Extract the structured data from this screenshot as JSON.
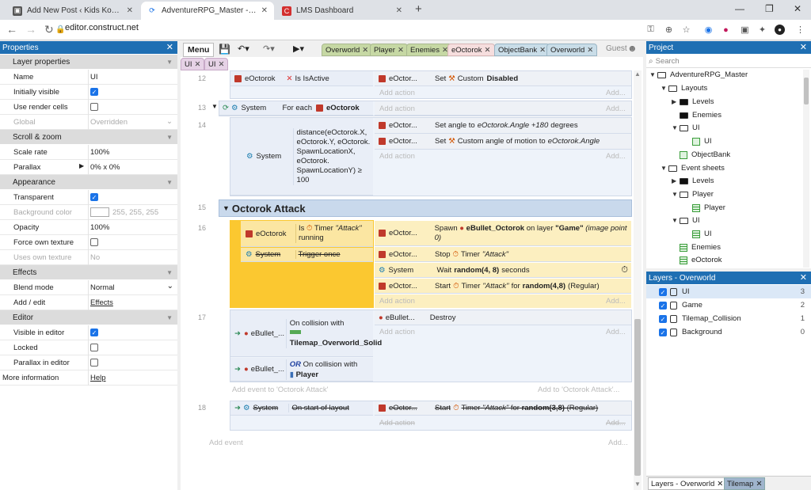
{
  "browser": {
    "tabs": [
      {
        "title": "Add New Post ‹ Kids Koding Aca",
        "active": false
      },
      {
        "title": "AdventureRPG_Master - Constru",
        "active": true
      },
      {
        "title": "LMS Dashboard",
        "active": false
      }
    ],
    "new_tab": "+",
    "url": "editor.construct.net"
  },
  "properties": {
    "title": "Properties",
    "sections": {
      "layer": "Layer properties",
      "scroll": "Scroll & zoom",
      "appearance": "Appearance",
      "effects": "Effects",
      "editor": "Editor"
    },
    "rows": {
      "name": {
        "k": "Name",
        "v": "UI"
      },
      "initially_visible": {
        "k": "Initially visible"
      },
      "use_render_cells": {
        "k": "Use render cells"
      },
      "global": {
        "k": "Global",
        "v": "Overridden"
      },
      "scale_rate": {
        "k": "Scale rate",
        "v": "100%"
      },
      "parallax": {
        "k": "Parallax",
        "v": "0% x 0%"
      },
      "transparent": {
        "k": "Transparent"
      },
      "bg_color": {
        "k": "Background color",
        "v": "255, 255, 255"
      },
      "opacity": {
        "k": "Opacity",
        "v": "100%"
      },
      "force_own_texture": {
        "k": "Force own texture"
      },
      "uses_own_texture": {
        "k": "Uses own texture",
        "v": "No"
      },
      "blend_mode": {
        "k": "Blend mode",
        "v": "Normal"
      },
      "add_edit": {
        "k": "Add / edit",
        "v": "Effects"
      },
      "visible_in_editor": {
        "k": "Visible in editor"
      },
      "locked": {
        "k": "Locked"
      },
      "parallax_in_editor": {
        "k": "Parallax in editor"
      },
      "more_info": {
        "k": "More information",
        "v": "Help"
      }
    }
  },
  "editor": {
    "menu": "Menu",
    "guest": "Guest",
    "tabs": [
      "Overworld",
      "Player",
      "Enemies",
      "eOctorok",
      "ObjectBank",
      "Overworld"
    ],
    "subtabs": [
      "UI",
      "UI"
    ],
    "events": {
      "e12": {
        "num": "12",
        "obj": "eOctorok",
        "cond": "Is IsActive",
        "aobj": "eOctor...",
        "act": "Set",
        "actb": "Custom",
        "actc": "Disabled"
      },
      "e13": {
        "num": "13",
        "sys": "System",
        "cond": "For each",
        "condobj": "eOctorok"
      },
      "e14": {
        "num": "14",
        "sys": "System",
        "cond": "distance(eOctorok.X, eOctorok.Y, eOctorok. SpawnLocationX, eOctorok. SpawnLocationY) ≥ 100",
        "a1obj": "eOctor...",
        "a1": "Set angle to",
        "a1i": "eOctorok.Angle +180",
        "a1e": "degrees",
        "a2obj": "eOctor...",
        "a2": "Set",
        "a2b": "Custom angle of motion to",
        "a2i": "eOctorok.Angle"
      },
      "e15": {
        "num": "15",
        "group": "Octorok Attack"
      },
      "e16": {
        "num": "16",
        "c1obj": "eOctorok",
        "c1": "Is",
        "c1b": "Timer",
        "c1i": "\"Attack\"",
        "c1e": "running",
        "c2sys": "System",
        "c2": "Trigger once",
        "a1obj": "eOctor...",
        "a1": "Spawn",
        "a1b": "eBullet_Octorok",
        "a1c": "on layer",
        "a1d": "\"Game\"",
        "a1i": "(image point 0)",
        "a2obj": "eOctor...",
        "a2": "Stop",
        "a2b": "Timer",
        "a2i": "\"Attack\"",
        "a3sys": "System",
        "a3": "Wait",
        "a3b": "random(4, 8)",
        "a3c": "seconds",
        "a4obj": "eOctor...",
        "a4": "Start",
        "a4b": "Timer",
        "a4i": "\"Attack\"",
        "a4c": "for",
        "a4d": "random(4,8)",
        "a4e": "(Regular)"
      },
      "e17": {
        "num": "17",
        "c1obj": "eBullet_...",
        "c1": "On collision with",
        "c1b": "Tilemap_Overworld_Solid",
        "c2obj": "eBullet_...",
        "c2or": "OR",
        "c2": "On collision with",
        "c2b": "Player",
        "a1obj": "eBullet...",
        "a1": "Destroy"
      },
      "add_event_group": "Add event to 'Octorok Attack'",
      "add_event_group_r": "Add to 'Octorok Attack'...",
      "e18": {
        "num": "18",
        "sys": "System",
        "cond": "On start of layout",
        "aobj": "eOctor...",
        "act": "Start",
        "actb": "Timer",
        "acti": "\"Attack\"",
        "actc": "for",
        "actd": "random(3,8)",
        "acte": "(Regular)"
      },
      "add_action": "Add action",
      "add_dots": "Add...",
      "add_event": "Add event"
    }
  },
  "project": {
    "title": "Project",
    "search_placeholder": "Search",
    "tree": {
      "root": "AdventureRPG_Master",
      "layouts": "Layouts",
      "levels": "Levels",
      "enemies": "Enemies",
      "ui": "UI",
      "ui_layout": "UI",
      "objectbank": "ObjectBank",
      "eventsheets": "Event sheets",
      "levels2": "Levels",
      "player": "Player",
      "player_sheet": "Player",
      "ui2": "UI",
      "ui_sheet": "UI",
      "enemies_sheet": "Enemies",
      "eoctorok_sheet": "eOctorok"
    }
  },
  "layers": {
    "title": "Layers - Overworld",
    "rows": [
      {
        "name": "UI",
        "n": "3"
      },
      {
        "name": "Game",
        "n": "2"
      },
      {
        "name": "Tilemap_Collision",
        "n": "1"
      },
      {
        "name": "Background",
        "n": "0"
      }
    ],
    "bottom_tabs": [
      "Layers - Overworld",
      "Tilemap"
    ]
  }
}
